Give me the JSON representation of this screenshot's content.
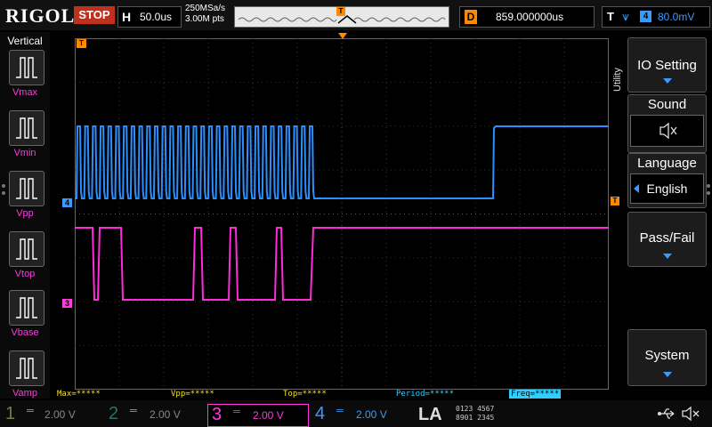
{
  "brand": "RIGOL",
  "run_state": "STOP",
  "horizontal": {
    "label": "H",
    "timebase": "50.0us"
  },
  "acquisition": {
    "sample_rate": "250MSa/s",
    "memory_depth": "3.00M pts"
  },
  "trigger_marker": "T",
  "delay": {
    "label": "D",
    "value": "859.000000us"
  },
  "trigger": {
    "label": "T",
    "source": "4",
    "level": "80.0mV"
  },
  "left_panel": {
    "title": "Vertical",
    "measurements": [
      {
        "label": "Vmax"
      },
      {
        "label": "Vmin"
      },
      {
        "label": "Vpp"
      },
      {
        "label": "Vtop"
      },
      {
        "label": "Vbase"
      },
      {
        "label": "Vamp"
      }
    ]
  },
  "right_panel": {
    "side_tab": "Utility",
    "io_setting": "IO Setting",
    "sound": "Sound",
    "language_title": "Language",
    "language_value": "English",
    "pass_fail": "Pass/Fail",
    "system": "System"
  },
  "measure_row": {
    "max": "Max=*****",
    "vpp": "Vpp=*****",
    "top": "Top=*****",
    "period": "Period=*****",
    "freq": "Freq=*****"
  },
  "channels": [
    {
      "num": "1",
      "scale": "2.00 V"
    },
    {
      "num": "2",
      "scale": "2.00 V"
    },
    {
      "num": "3",
      "scale": "2.00 V"
    },
    {
      "num": "4",
      "scale": "2.00 V"
    }
  ],
  "la": {
    "label": "LA",
    "row1": "0123 4567",
    "row2": "8901 2345"
  },
  "channel_markers": {
    "ch4": "4",
    "ch3": "3",
    "trig": "T"
  },
  "colors": {
    "ch3": "#ff3adf",
    "ch4": "#3a9bff",
    "trigger": "#ff8a00",
    "stop": "#c0301c"
  }
}
